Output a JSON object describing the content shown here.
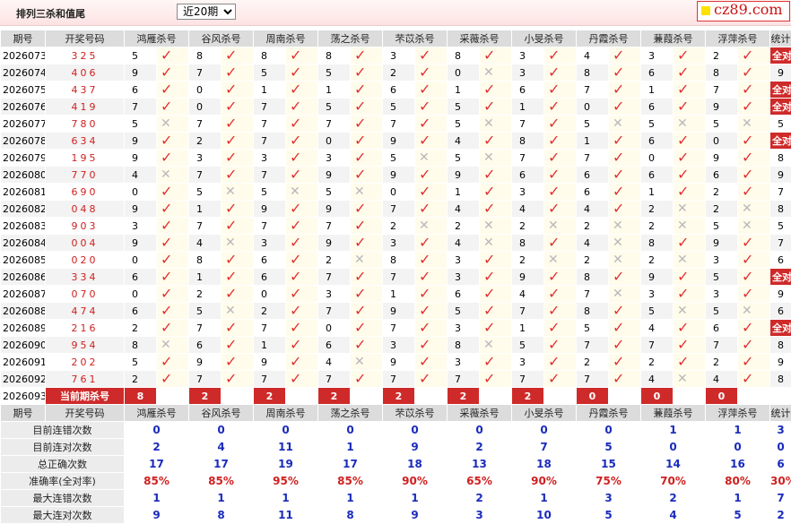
{
  "header": {
    "title": "排列三杀和值尾",
    "select_value": "近20期",
    "select_options": [
      "近20期"
    ]
  },
  "logo": {
    "text": "cz89.com"
  },
  "columns": {
    "issue": "期号",
    "draw": "开奖号码",
    "stat": "统计",
    "methods": [
      "鸿雁杀号",
      "谷风杀号",
      "周南杀号",
      "荡之杀号",
      "芣苡杀号",
      "采薇杀号",
      "小旻杀号",
      "丹霞杀号",
      "蒹葭杀号",
      "浮萍杀号"
    ]
  },
  "full_right_label": "全对",
  "rows": [
    {
      "issue": "2026073",
      "draw": "325",
      "kills": [
        [
          5,
          1
        ],
        [
          8,
          1
        ],
        [
          8,
          1
        ],
        [
          8,
          1
        ],
        [
          3,
          1
        ],
        [
          8,
          1
        ],
        [
          3,
          1
        ],
        [
          4,
          1
        ],
        [
          3,
          1
        ],
        [
          2,
          1
        ]
      ],
      "stat": "全对"
    },
    {
      "issue": "2026074",
      "draw": "406",
      "kills": [
        [
          9,
          1
        ],
        [
          7,
          1
        ],
        [
          5,
          1
        ],
        [
          5,
          1
        ],
        [
          2,
          1
        ],
        [
          0,
          0
        ],
        [
          3,
          1
        ],
        [
          8,
          1
        ],
        [
          6,
          1
        ],
        [
          8,
          1
        ]
      ],
      "stat": "9"
    },
    {
      "issue": "2026075",
      "draw": "437",
      "kills": [
        [
          6,
          1
        ],
        [
          0,
          1
        ],
        [
          1,
          1
        ],
        [
          1,
          1
        ],
        [
          6,
          1
        ],
        [
          1,
          1
        ],
        [
          6,
          1
        ],
        [
          7,
          1
        ],
        [
          1,
          1
        ],
        [
          7,
          1
        ]
      ],
      "stat": "全对"
    },
    {
      "issue": "2026076",
      "draw": "419",
      "kills": [
        [
          7,
          1
        ],
        [
          0,
          1
        ],
        [
          7,
          1
        ],
        [
          5,
          1
        ],
        [
          5,
          1
        ],
        [
          5,
          1
        ],
        [
          1,
          1
        ],
        [
          0,
          1
        ],
        [
          6,
          1
        ],
        [
          9,
          1
        ]
      ],
      "stat": "全对"
    },
    {
      "issue": "2026077",
      "draw": "780",
      "kills": [
        [
          5,
          0
        ],
        [
          7,
          1
        ],
        [
          7,
          1
        ],
        [
          7,
          1
        ],
        [
          7,
          1
        ],
        [
          5,
          0
        ],
        [
          7,
          1
        ],
        [
          5,
          0
        ],
        [
          5,
          0
        ],
        [
          5,
          0
        ]
      ],
      "stat": "5"
    },
    {
      "issue": "2026078",
      "draw": "634",
      "kills": [
        [
          9,
          1
        ],
        [
          2,
          1
        ],
        [
          7,
          1
        ],
        [
          0,
          1
        ],
        [
          9,
          1
        ],
        [
          4,
          1
        ],
        [
          8,
          1
        ],
        [
          1,
          1
        ],
        [
          6,
          1
        ],
        [
          0,
          1
        ]
      ],
      "stat": "全对"
    },
    {
      "issue": "2026079",
      "draw": "195",
      "kills": [
        [
          9,
          1
        ],
        [
          3,
          1
        ],
        [
          3,
          1
        ],
        [
          3,
          1
        ],
        [
          5,
          0
        ],
        [
          5,
          0
        ],
        [
          7,
          1
        ],
        [
          7,
          1
        ],
        [
          0,
          1
        ],
        [
          9,
          1
        ]
      ],
      "stat": "8"
    },
    {
      "issue": "2026080",
      "draw": "770",
      "kills": [
        [
          4,
          0
        ],
        [
          7,
          1
        ],
        [
          7,
          1
        ],
        [
          9,
          1
        ],
        [
          9,
          1
        ],
        [
          9,
          1
        ],
        [
          6,
          1
        ],
        [
          6,
          1
        ],
        [
          6,
          1
        ],
        [
          6,
          1
        ]
      ],
      "stat": "9"
    },
    {
      "issue": "2026081",
      "draw": "690",
      "kills": [
        [
          0,
          1
        ],
        [
          5,
          0
        ],
        [
          5,
          0
        ],
        [
          5,
          0
        ],
        [
          0,
          1
        ],
        [
          1,
          1
        ],
        [
          3,
          1
        ],
        [
          6,
          1
        ],
        [
          1,
          1
        ],
        [
          2,
          1
        ]
      ],
      "stat": "7"
    },
    {
      "issue": "2026082",
      "draw": "048",
      "kills": [
        [
          9,
          1
        ],
        [
          1,
          1
        ],
        [
          9,
          1
        ],
        [
          9,
          1
        ],
        [
          7,
          1
        ],
        [
          4,
          1
        ],
        [
          4,
          1
        ],
        [
          4,
          1
        ],
        [
          2,
          0
        ],
        [
          2,
          0
        ]
      ],
      "stat": "8"
    },
    {
      "issue": "2026083",
      "draw": "903",
      "kills": [
        [
          3,
          1
        ],
        [
          7,
          1
        ],
        [
          7,
          1
        ],
        [
          7,
          1
        ],
        [
          2,
          0
        ],
        [
          2,
          0
        ],
        [
          2,
          0
        ],
        [
          2,
          0
        ],
        [
          2,
          0
        ],
        [
          5,
          0
        ]
      ],
      "stat": "5"
    },
    {
      "issue": "2026084",
      "draw": "004",
      "kills": [
        [
          9,
          1
        ],
        [
          4,
          0
        ],
        [
          3,
          1
        ],
        [
          9,
          1
        ],
        [
          3,
          1
        ],
        [
          4,
          0
        ],
        [
          8,
          1
        ],
        [
          4,
          0
        ],
        [
          8,
          1
        ],
        [
          9,
          1
        ]
      ],
      "stat": "7"
    },
    {
      "issue": "2026085",
      "draw": "020",
      "kills": [
        [
          0,
          1
        ],
        [
          8,
          1
        ],
        [
          6,
          1
        ],
        [
          2,
          0
        ],
        [
          8,
          1
        ],
        [
          3,
          1
        ],
        [
          2,
          0
        ],
        [
          2,
          0
        ],
        [
          2,
          0
        ],
        [
          3,
          1
        ]
      ],
      "stat": "6"
    },
    {
      "issue": "2026086",
      "draw": "334",
      "kills": [
        [
          6,
          1
        ],
        [
          1,
          1
        ],
        [
          6,
          1
        ],
        [
          7,
          1
        ],
        [
          7,
          1
        ],
        [
          3,
          1
        ],
        [
          9,
          1
        ],
        [
          8,
          1
        ],
        [
          9,
          1
        ],
        [
          5,
          1
        ]
      ],
      "stat": "全对"
    },
    {
      "issue": "2026087",
      "draw": "070",
      "kills": [
        [
          0,
          1
        ],
        [
          2,
          1
        ],
        [
          0,
          1
        ],
        [
          3,
          1
        ],
        [
          1,
          1
        ],
        [
          6,
          1
        ],
        [
          4,
          1
        ],
        [
          7,
          0
        ],
        [
          3,
          1
        ],
        [
          3,
          1
        ]
      ],
      "stat": "9"
    },
    {
      "issue": "2026088",
      "draw": "474",
      "kills": [
        [
          6,
          1
        ],
        [
          5,
          0
        ],
        [
          2,
          1
        ],
        [
          7,
          1
        ],
        [
          9,
          1
        ],
        [
          5,
          1
        ],
        [
          7,
          1
        ],
        [
          8,
          1
        ],
        [
          5,
          0
        ],
        [
          5,
          0
        ]
      ],
      "stat": "6"
    },
    {
      "issue": "2026089",
      "draw": "216",
      "kills": [
        [
          2,
          1
        ],
        [
          7,
          1
        ],
        [
          7,
          1
        ],
        [
          0,
          1
        ],
        [
          7,
          1
        ],
        [
          3,
          1
        ],
        [
          1,
          1
        ],
        [
          5,
          1
        ],
        [
          4,
          1
        ],
        [
          6,
          1
        ]
      ],
      "stat": "全对"
    },
    {
      "issue": "2026090",
      "draw": "954",
      "kills": [
        [
          8,
          0
        ],
        [
          6,
          1
        ],
        [
          1,
          1
        ],
        [
          6,
          1
        ],
        [
          3,
          1
        ],
        [
          8,
          0
        ],
        [
          5,
          1
        ],
        [
          7,
          1
        ],
        [
          7,
          1
        ],
        [
          7,
          1
        ]
      ],
      "stat": "8"
    },
    {
      "issue": "2026091",
      "draw": "202",
      "kills": [
        [
          5,
          1
        ],
        [
          9,
          1
        ],
        [
          9,
          1
        ],
        [
          4,
          0
        ],
        [
          9,
          1
        ],
        [
          3,
          1
        ],
        [
          3,
          1
        ],
        [
          2,
          1
        ],
        [
          2,
          1
        ],
        [
          2,
          1
        ]
      ],
      "stat": "9"
    },
    {
      "issue": "2026092",
      "draw": "761",
      "kills": [
        [
          2,
          1
        ],
        [
          7,
          1
        ],
        [
          7,
          1
        ],
        [
          7,
          1
        ],
        [
          7,
          1
        ],
        [
          7,
          1
        ],
        [
          7,
          1
        ],
        [
          7,
          1
        ],
        [
          4,
          0
        ],
        [
          4,
          1
        ]
      ],
      "stat": "8"
    }
  ],
  "current": {
    "issue": "2026093",
    "label": "当前期杀号",
    "values": [
      "8",
      "2",
      "2",
      "2",
      "2",
      "2",
      "2",
      "0",
      "0",
      "0"
    ]
  },
  "summary": [
    {
      "label": "目前连错次数",
      "values": [
        "0",
        "0",
        "0",
        "0",
        "0",
        "0",
        "0",
        "0",
        "1",
        "1",
        "3"
      ]
    },
    {
      "label": "目前连对次数",
      "values": [
        "2",
        "4",
        "11",
        "1",
        "9",
        "2",
        "7",
        "5",
        "0",
        "0",
        "0"
      ]
    },
    {
      "label": "总正确次数",
      "values": [
        "17",
        "17",
        "19",
        "17",
        "18",
        "13",
        "18",
        "15",
        "14",
        "16",
        "6"
      ]
    },
    {
      "label": "准确率(全对率)",
      "values": [
        "85%",
        "85%",
        "95%",
        "85%",
        "90%",
        "65%",
        "90%",
        "75%",
        "70%",
        "80%",
        "30%"
      ]
    },
    {
      "label": "最大连错次数",
      "values": [
        "1",
        "1",
        "1",
        "1",
        "1",
        "2",
        "1",
        "3",
        "2",
        "1",
        "7"
      ]
    },
    {
      "label": "最大连对次数",
      "values": [
        "9",
        "8",
        "11",
        "8",
        "9",
        "3",
        "10",
        "5",
        "4",
        "5",
        "2"
      ]
    }
  ],
  "icons": {
    "right": "check-icon",
    "wrong": "cross-icon"
  },
  "colors": {
    "accent_red": "#cf2a2a",
    "summary_blue": "#1a2bbd",
    "draw_red": "#d02020"
  }
}
